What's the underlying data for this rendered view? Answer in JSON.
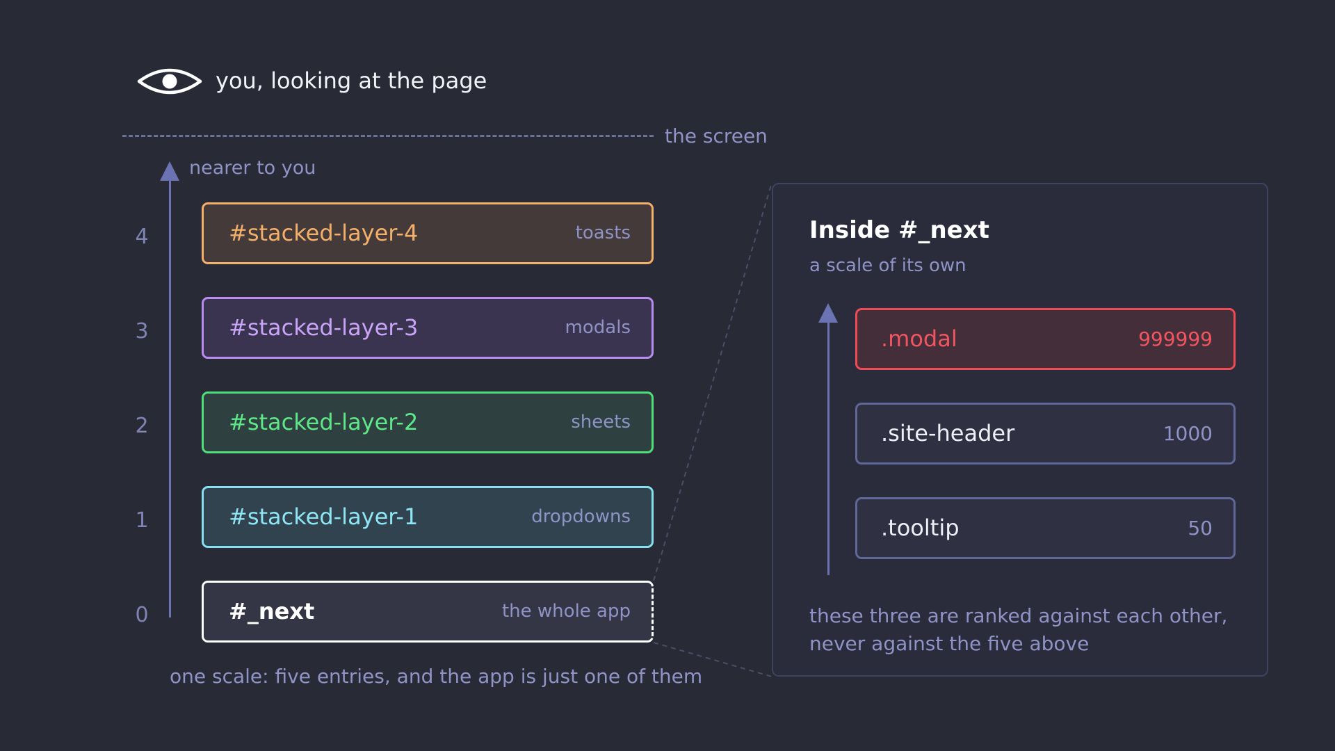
{
  "header": {
    "eye_icon": "eye-icon",
    "caption": "you, looking at the page",
    "screen_label": "the screen"
  },
  "stack": {
    "axis_label": "nearer to you",
    "layers": [
      {
        "index": "4",
        "name": "#stacked-layer-4",
        "role": "toasts",
        "border": "#f4b06b",
        "fill": "#443a39",
        "text": "#f4b06b"
      },
      {
        "index": "3",
        "name": "#stacked-layer-3",
        "role": "modals",
        "border": "#b98cf2",
        "fill": "#3a3450",
        "text": "#c9a4f7"
      },
      {
        "index": "2",
        "name": "#stacked-layer-2",
        "role": "sheets",
        "border": "#4fe07a",
        "fill": "#2e4140",
        "text": "#5ee888"
      },
      {
        "index": "1",
        "name": "#stacked-layer-1",
        "role": "dropdowns",
        "border": "#86e0f0",
        "fill": "#31434f",
        "text": "#8ee6f4"
      },
      {
        "index": "0",
        "name": "#_next",
        "role": "the whole app",
        "border": "#ffffff",
        "fill": "#343645",
        "text": "#ffffff"
      }
    ],
    "caption": "one scale: five entries, and the app is just one of them"
  },
  "panel": {
    "title": "Inside #_next",
    "subtitle": "a scale of its own",
    "items": [
      {
        "name": ".modal",
        "value": "999999",
        "border": "#ee4b55",
        "fill": "#432e3a",
        "text": "#f15560"
      },
      {
        "name": ".site-header",
        "value": "1000",
        "border": "#5f6899",
        "fill": "#2f3142",
        "text": "#eef0f8"
      },
      {
        "name": ".tooltip",
        "value": "50",
        "border": "#5f6899",
        "fill": "#2f3142",
        "text": "#eef0f8"
      }
    ],
    "note_line1": "these three are ranked against each other,",
    "note_line2": "never against the five above"
  }
}
